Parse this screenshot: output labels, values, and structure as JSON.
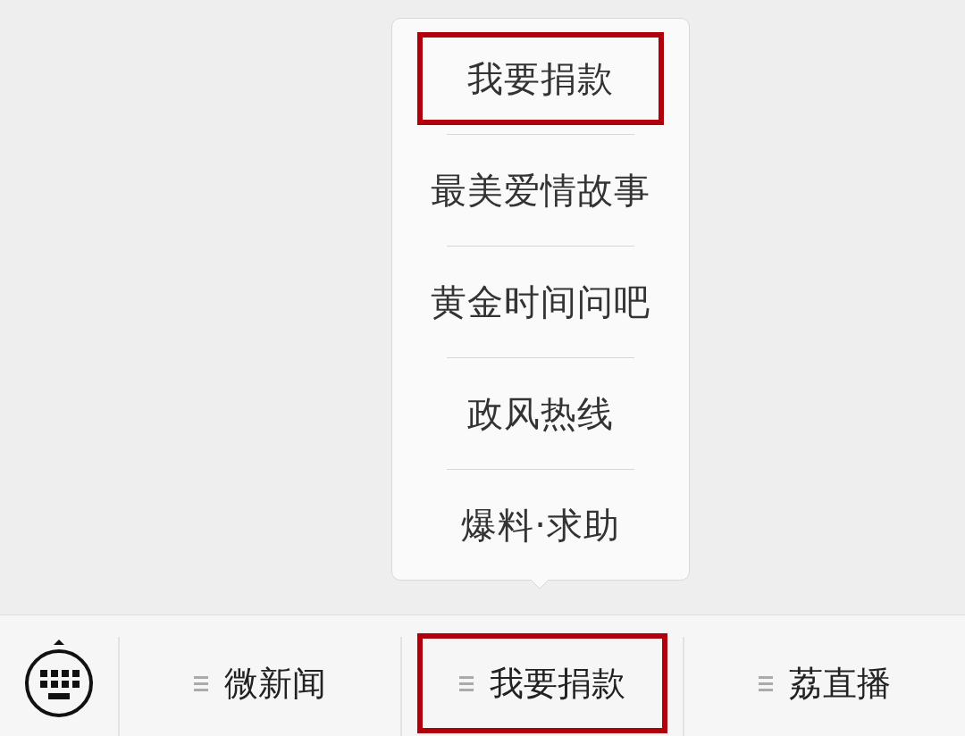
{
  "popup_menu": {
    "items": [
      {
        "label": "我要捐款",
        "highlighted": true
      },
      {
        "label": "最美爱情故事",
        "highlighted": false
      },
      {
        "label": "黄金时间问吧",
        "highlighted": false
      },
      {
        "label": "政风热线",
        "highlighted": false
      },
      {
        "label": "爆料·求助",
        "highlighted": false
      }
    ]
  },
  "bottom_menu": {
    "tabs": [
      {
        "label": "微新闻",
        "highlighted": false
      },
      {
        "label": "我要捐款",
        "highlighted": true
      },
      {
        "label": "荔直播",
        "highlighted": false
      }
    ]
  }
}
